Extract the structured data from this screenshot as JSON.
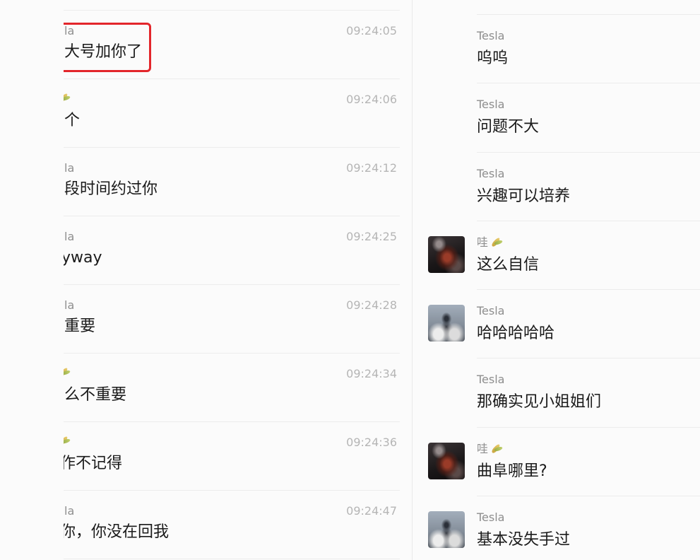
{
  "colors": {
    "background": "#fbfbfb",
    "divider": "#ececec",
    "name_text": "#8e8e8e",
    "timestamp_text": "#b5b5b5",
    "message_text": "#1a1a1a",
    "highlight_border": "#e3262b"
  },
  "left_column": {
    "rows": [
      {
        "name": "la",
        "time": "09:24:05",
        "message": "大号加你了",
        "highlighted": true
      },
      {
        "name_icon": "rice-ear-emoji-icon",
        "time": "09:24:06",
        "message": "个"
      },
      {
        "name": "la",
        "time": "09:24:12",
        "message": "段时间约过你"
      },
      {
        "name": "la",
        "time": "09:24:25",
        "message": "yway"
      },
      {
        "name": "la",
        "time": "09:24:28",
        "message": "重要"
      },
      {
        "name_icon": "rice-ear-emoji-icon",
        "time": "09:24:34",
        "message": "么不重要"
      },
      {
        "name_icon": "rice-ear-emoji-icon",
        "time": "09:24:36",
        "message": "作不记得"
      },
      {
        "name": "la",
        "time": "09:24:47",
        "message": "你，你没在回我"
      }
    ]
  },
  "right_column": {
    "rows": [
      {
        "name": "Tesla",
        "message": "呜呜"
      },
      {
        "name": "Tesla",
        "message": "问题不大"
      },
      {
        "name": "Tesla",
        "message": "兴趣可以培养"
      },
      {
        "name": "哇",
        "name_icon": "rice-ear-emoji-icon",
        "message": "这么自信",
        "avatar": "wa-avatar"
      },
      {
        "name": "Tesla",
        "message": "哈哈哈哈哈",
        "avatar": "tesla-avatar"
      },
      {
        "name": "Tesla",
        "message": "那确实见小姐姐们"
      },
      {
        "name": "哇",
        "name_icon": "rice-ear-emoji-icon",
        "message": "曲阜哪里?",
        "avatar": "wa-avatar"
      },
      {
        "name": "Tesla",
        "message": "基本没失手过",
        "avatar": "tesla-avatar"
      }
    ]
  }
}
